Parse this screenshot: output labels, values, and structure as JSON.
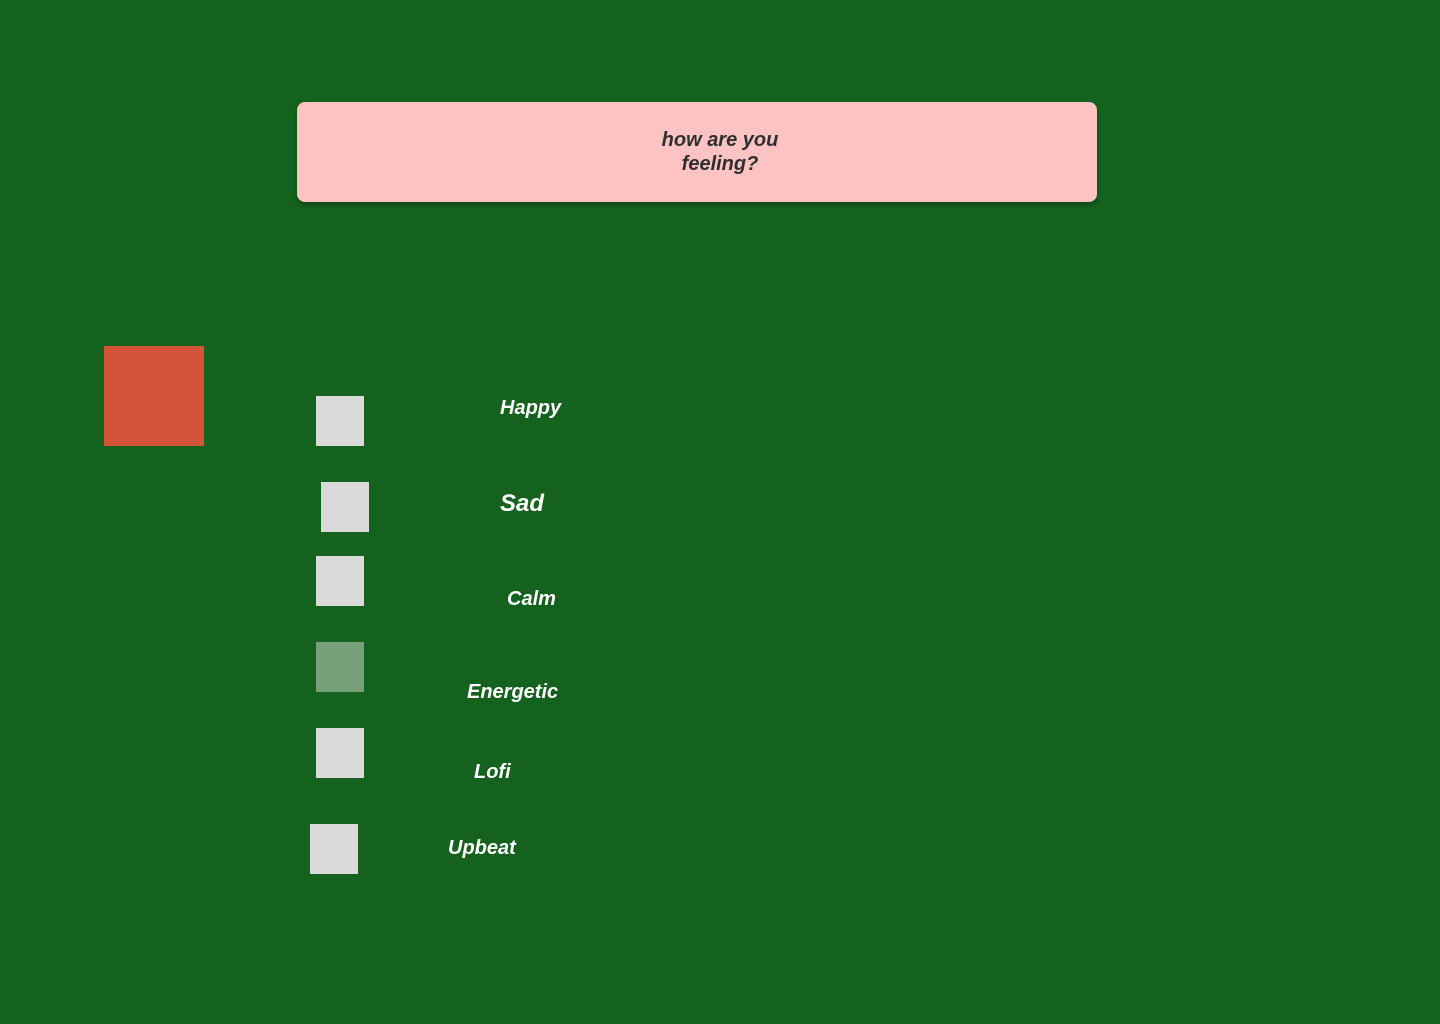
{
  "question": {
    "line1": "how are you",
    "line2": "feeling?"
  },
  "colors": {
    "background": "#14621d",
    "card": "#fdc3c3",
    "accent": "#d45439",
    "checkbox": "#d9d9d9",
    "checkbox_selected": "#75a079"
  },
  "moods": [
    {
      "label": "Happy",
      "selected": false
    },
    {
      "label": "Sad",
      "selected": false
    },
    {
      "label": "Calm",
      "selected": false
    },
    {
      "label": "Energetic",
      "selected": true
    },
    {
      "label": "Lofi",
      "selected": false
    },
    {
      "label": "Upbeat",
      "selected": false
    }
  ]
}
